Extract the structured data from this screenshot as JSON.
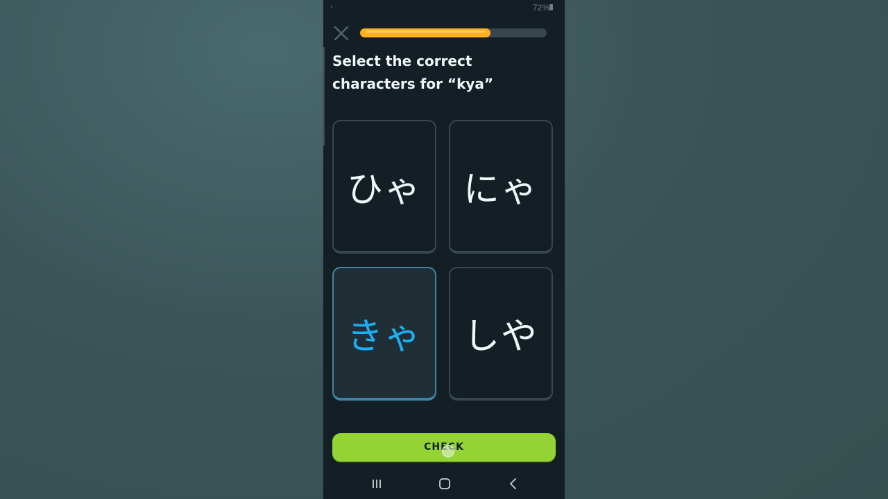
{
  "status_bar": {
    "battery": "72%"
  },
  "lesson": {
    "progress": 0.7,
    "prompt": "Select the correct characters for “kya”"
  },
  "options": [
    {
      "label": "ひゃ",
      "selected": false
    },
    {
      "label": "にゃ",
      "selected": false
    },
    {
      "label": "きゃ",
      "selected": true
    },
    {
      "label": "しや",
      "selected": false
    }
  ],
  "check_button": {
    "label": "CHECK"
  },
  "colors": {
    "background": "#131f24",
    "progress": "#ffb020",
    "selected_text": "#1cb0f6",
    "selected_border": "#3f85a7",
    "check_button": "#93d333"
  },
  "icons": {
    "close": "close-icon",
    "recents": "recents-icon",
    "home": "home-icon",
    "back": "back-icon"
  }
}
